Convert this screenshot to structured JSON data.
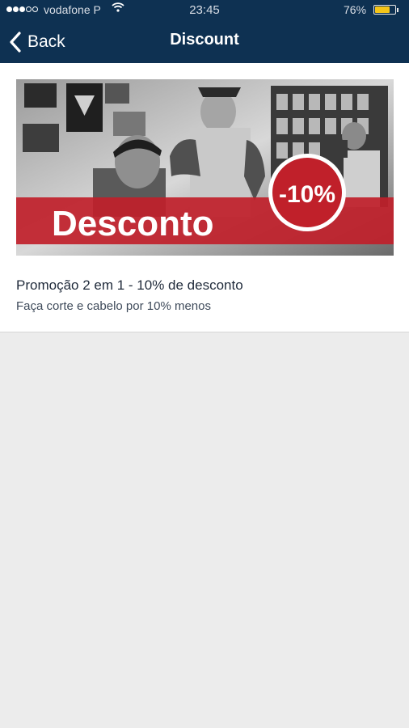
{
  "status_bar": {
    "carrier": "vodafone P",
    "time": "23:45",
    "battery": "76%",
    "battery_level": 0.76
  },
  "nav": {
    "back_label": "Back",
    "title": "Discount"
  },
  "promo": {
    "banner_text": "Desconto",
    "badge_text": "-10%",
    "title": "Promoção 2 em 1 - 10% de desconto",
    "subtitle": "Faça corte e cabelo por 10% menos"
  },
  "colors": {
    "navbar": "#0e3152",
    "banner_red": "#c0202a",
    "background": "#ececec"
  }
}
